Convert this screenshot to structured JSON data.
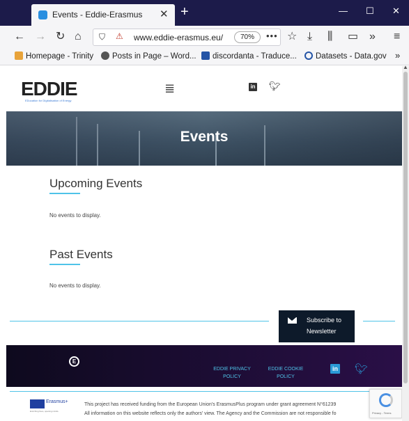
{
  "browser": {
    "tab_title": "Events - Eddie-Erasmus",
    "url": "www.eddie-erasmus.eu/",
    "zoom": "70%",
    "bookmarks": [
      {
        "label": "Homepage - Trinity",
        "icon": "trinity-icon"
      },
      {
        "label": "Posts in Page – Word...",
        "icon": "wordpress-icon"
      },
      {
        "label": "discordanta - Traduce...",
        "icon": "translate-icon"
      },
      {
        "label": "Datasets - Data.gov",
        "icon": "datagov-icon"
      }
    ]
  },
  "site": {
    "logo_text": "EDDIE",
    "logo_sub": "EDucation for DIgitalisation of Energy",
    "hero_title": "Events",
    "upcoming": {
      "title": "Upcoming Events",
      "empty_text": "No events to display."
    },
    "past": {
      "title": "Past Events",
      "empty_text": "No events to display."
    },
    "subscribe": {
      "line1": "Subscribe to",
      "line2": "Newsletter"
    },
    "footer": {
      "privacy_line1": "EDDIE PRIVACY",
      "privacy_line2": "POLICY",
      "cookie_line1": "EDDIE COOKIE",
      "cookie_line2": "POLICY"
    },
    "funding": {
      "erasmus_label": "Erasmus+",
      "erasmus_sub": "Enriching lives, opening minds.",
      "line1": "This project has received funding from the European Union's ErasmusPlus program under grant agreement N°61239",
      "line2": "All information on this website reflects only the authors' view. The Agency and the Commission are not responsible fo"
    },
    "recaptcha_text": "Privacy - Terms"
  },
  "colors": {
    "accent": "#4fc3e8",
    "titlebar": "#1c1b4a",
    "footer": "#1d0d35"
  }
}
